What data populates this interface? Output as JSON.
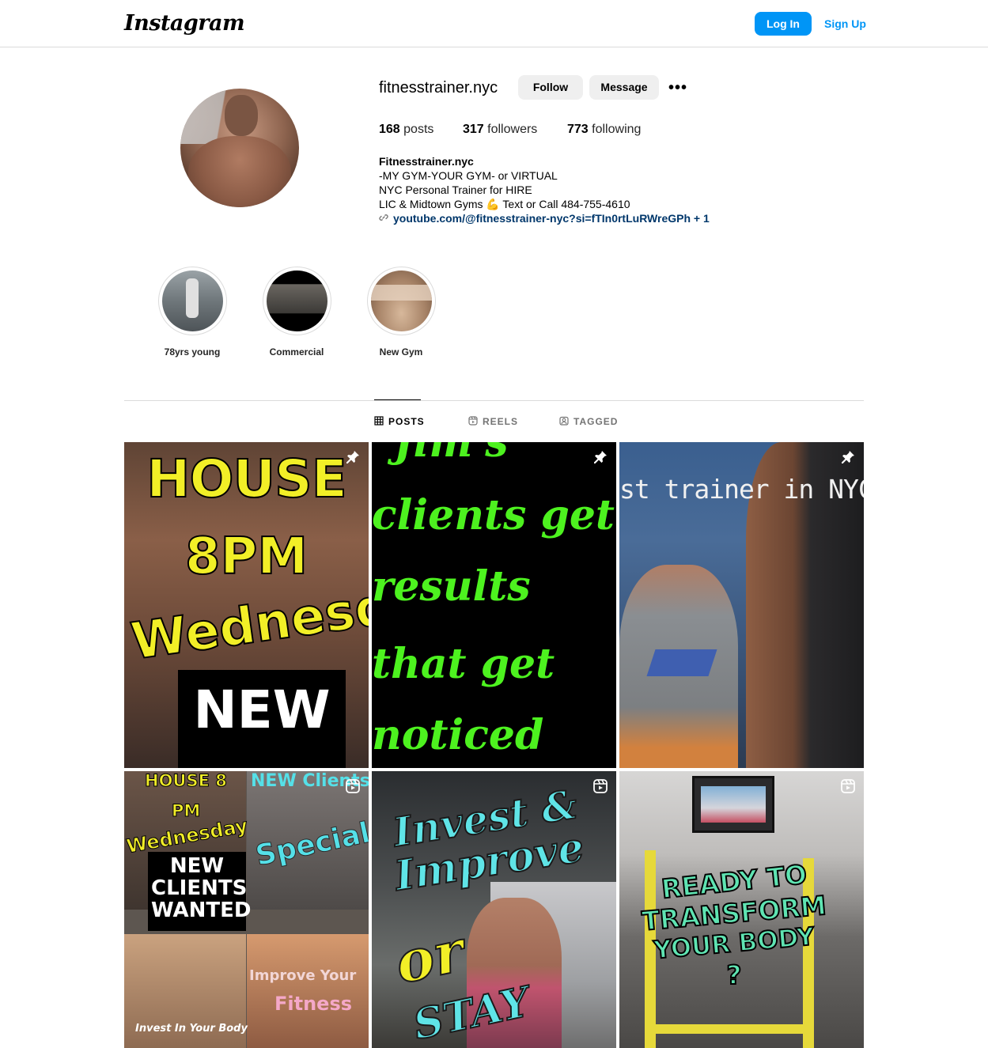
{
  "header": {
    "logo": "Instagram",
    "login_label": "Log In",
    "signup_label": "Sign Up",
    "accent_color": "#0095f6"
  },
  "profile": {
    "username": "fitnesstrainer.nyc",
    "follow_label": "Follow",
    "message_label": "Message",
    "more_label": "•••",
    "stats": {
      "posts_count": "168",
      "posts_label": "posts",
      "followers_count": "317",
      "followers_label": "followers",
      "following_count": "773",
      "following_label": "following"
    },
    "bio": {
      "name": "Fitnesstrainer.nyc",
      "lines": [
        "-MY GYM-YOUR GYM- or VIRTUAL",
        "NYC Personal Trainer for HIRE",
        "LIC & Midtown Gyms 💪 Text or Call 484-755-4610"
      ],
      "link": "youtube.com/@fitnesstrainer-nyc?si=fTIn0rtLuRWreGPh + 1"
    }
  },
  "highlights": [
    {
      "label": "78yrs young"
    },
    {
      "label": "Commercial"
    },
    {
      "label": "New Gym"
    }
  ],
  "tabs": [
    {
      "label": "POSTS",
      "icon": "grid-icon",
      "active": true
    },
    {
      "label": "REELS",
      "icon": "reels-icon",
      "active": false
    },
    {
      "label": "TAGGED",
      "icon": "tagged-icon",
      "active": false
    }
  ],
  "posts": [
    {
      "badge": "pin-icon",
      "text": [
        "HOUSE",
        "8PM",
        "Wednesday",
        "NEW"
      ]
    },
    {
      "badge": "pin-icon",
      "text": [
        "Jim's",
        "clients get",
        "results",
        "that get",
        "noticed"
      ]
    },
    {
      "badge": "pin-icon",
      "text": [
        "st trainer in NYC\""
      ]
    },
    {
      "badge": "reel-icon",
      "text": [
        "HOUSE 8",
        "PM",
        "Wednesday",
        "NEW CLIENTS WANTED",
        "Specials",
        "NEW Clients",
        "Improve Your",
        "Fitness",
        "Invest In Your Body"
      ]
    },
    {
      "badge": "reel-icon",
      "text": [
        "Invest &",
        "Improve",
        "or",
        "STAY"
      ]
    },
    {
      "badge": "reel-icon",
      "text": [
        "READY TO",
        "TRANSFORM",
        "YOUR BODY",
        "?"
      ]
    }
  ]
}
